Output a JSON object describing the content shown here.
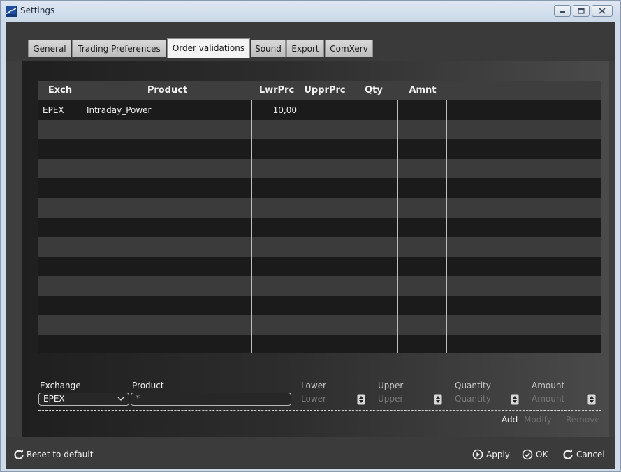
{
  "window": {
    "title": "Settings"
  },
  "tabs": [
    {
      "label": "General",
      "active": false
    },
    {
      "label": "Trading Preferences",
      "active": false
    },
    {
      "label": "Order validations",
      "active": true
    },
    {
      "label": "Sound",
      "active": false
    },
    {
      "label": "Export",
      "active": false
    },
    {
      "label": "ComXerv",
      "active": false
    }
  ],
  "grid": {
    "columns": [
      "Exch",
      "Product",
      "LwrPrc",
      "UpprPrc",
      "Qty",
      "Amnt"
    ],
    "rows": [
      {
        "exch": "EPEX",
        "product": "Intraday_Power",
        "lwrprc": "10,00",
        "upprprc": "",
        "qty": "",
        "amnt": ""
      }
    ]
  },
  "form": {
    "exchange": {
      "label": "Exchange",
      "value": "EPEX"
    },
    "product": {
      "label": "Product",
      "value": "*"
    },
    "lower": {
      "label": "Lower",
      "placeholder": "Lower"
    },
    "upper": {
      "label": "Upper",
      "placeholder": "Upper"
    },
    "quantity": {
      "label": "Quantity",
      "placeholder": "Quantity"
    },
    "amount": {
      "label": "Amount",
      "placeholder": "Amount"
    },
    "actions": {
      "add": "Add",
      "modify": "Modify",
      "remove": "Remove"
    }
  },
  "footer": {
    "reset": "Reset to default",
    "apply": "Apply",
    "ok": "OK",
    "cancel": "Cancel"
  },
  "colors": {
    "panel_dark": "#1f1f1f",
    "row_dark": "#1b1b1b",
    "row_light": "#3b3b3b",
    "text": "#f0f0f0",
    "disabled_text": "#7a7a7a",
    "window_frame": "#cfdbe9"
  },
  "icons": {
    "app": "app-icon",
    "minimize": "minimize-icon",
    "maximize": "maximize-icon",
    "close": "close-icon",
    "reset": "refresh-icon",
    "apply": "play-circle-icon",
    "ok": "check-circle-icon",
    "cancel": "refresh-icon"
  }
}
